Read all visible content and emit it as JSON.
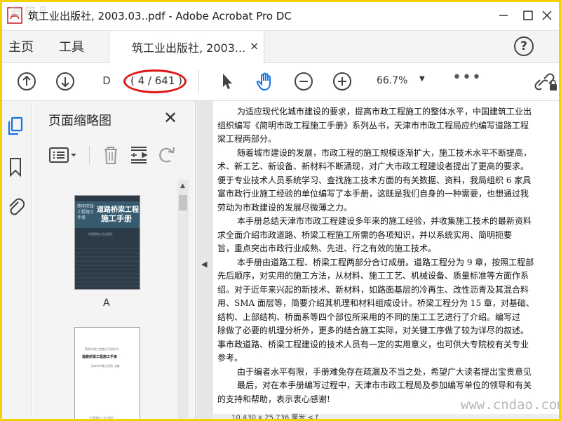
{
  "window": {
    "title": "筑工业出版社, 2003.03..pdf - Adobe Acrobat Pro DC"
  },
  "tabs": {
    "home": "主页",
    "tools": "工具",
    "document": "筑工业出版社, 2003...",
    "close": "×",
    "help": "?"
  },
  "toolbar": {
    "page_input": "D",
    "page_count": "( 4 / 641 )",
    "zoom": "66.7%",
    "zoom_caret": "▼",
    "more": "•••"
  },
  "thumbnails": {
    "title": "页面缩略图",
    "close": "✕",
    "items": [
      {
        "label": "A",
        "cover_title_1": "道路桥梁工程",
        "cover_title_2": "施工手册",
        "cover_vertical": "简明市政工程施工手册",
        "cover_subtitle": "中国建筑工业出版社"
      },
      {
        "line1": "简明市政工程施工手册系列",
        "line2": "道路桥梁工程施工手册",
        "line3": "天津市市政工程局 主编",
        "line4": "中国建筑工业出版社"
      }
    ]
  },
  "document": {
    "paragraphs": [
      {
        "text": "为适应现代化城市建设的要求，提高市政工程施工的整体水平，中国建筑工业出",
        "indent": true
      },
      {
        "text": "组织编写《简明市政工程施工手册》系列丛书，天津市市政工程局应约编写道路工程",
        "indent": false
      },
      {
        "text": "梁工程两部分。",
        "indent": false
      },
      {
        "text": "随着城市建设的发展，市政工程的施工规模逐渐扩大，施工技术水平不断提高，",
        "indent": true
      },
      {
        "text": "术、新工艺、新设备、新材料不断涌现，对广大市政工程建设者提出了更高的要求。",
        "indent": false
      },
      {
        "text": "便于专业技术人员系统学习、查找施工技术方面的有关数据、资料，我局组织 6 家具",
        "indent": false
      },
      {
        "text": "富市政行业施工经验的单位编写了本手册，这既是我们自身的一种需要，也想通过我",
        "indent": false
      },
      {
        "text": "劳动为市政建设的发展尽微薄之力。",
        "indent": false
      },
      {
        "text": "本手册总结天津市市政工程建设多年来的施工经验，并收集施工技术的最新资料",
        "indent": true
      },
      {
        "text": "求全面介绍市政道路、桥梁工程施工所需的各项知识，并以系统实用、简明扼要",
        "indent": false
      },
      {
        "text": "旨，重点突出市政行业成熟、先进、行之有效的施工技术。",
        "indent": false
      },
      {
        "text": "本手册由道路工程、桥梁工程两部分合订成册。道路工程分为 9 章，按照工程部",
        "indent": true
      },
      {
        "text": "先后顺序，对实用的施工方法，从材料、施工工艺、机械设备、质量标准等方面作系",
        "indent": false
      },
      {
        "text": "绍。对于近年来兴起的新技术、新材料，如路面基层的冷再生、改性沥青及其混合料",
        "indent": false
      },
      {
        "text": "用、SMA 面层等，简要介绍其机理和材料组成设计。桥梁工程分为 15 章，对基础、",
        "indent": false
      },
      {
        "text": "结构、上部结构、桥面系等四个部位所采用的不同的施工工艺进行了介绍。编写过",
        "indent": false
      },
      {
        "text": "除做了必要的机理分析外，更多的结合施工实际，对关键工序做了较为详尽的叙述。",
        "indent": false
      },
      {
        "text": "事市政道路、桥梁工程建设的技术人员有一定的实用意义，也可供大专院校有关专业",
        "indent": false
      },
      {
        "text": "参考。",
        "indent": false
      },
      {
        "text": "由于编者水平有限，手册难免存在疏漏及不当之处，希望广大读者提出宝贵意见",
        "indent": true
      },
      {
        "text": "最后，对在本手册编写过程中，天津市市政工程局及参加编写单位的领导和有关",
        "indent": true
      },
      {
        "text": "的支持和帮助，表示衷心感谢!",
        "indent": false
      }
    ],
    "status": "10.430 x 25.736 厘米  <  f"
  },
  "watermark": "www.cndao.com",
  "colors": {
    "page_ring": "#e01616",
    "frame": "#f2d200",
    "active_hand": "#1473e6"
  },
  "icons": [
    "acrobat-icon",
    "arrow-up-icon",
    "arrow-down-icon",
    "pointer-icon",
    "hand-icon",
    "zoom-out-icon",
    "zoom-in-icon",
    "share-link-icon",
    "thumbnails-icon",
    "bookmark-icon",
    "attachment-icon",
    "options-icon",
    "trash-icon",
    "extract-pages-icon",
    "rotate-icon"
  ]
}
